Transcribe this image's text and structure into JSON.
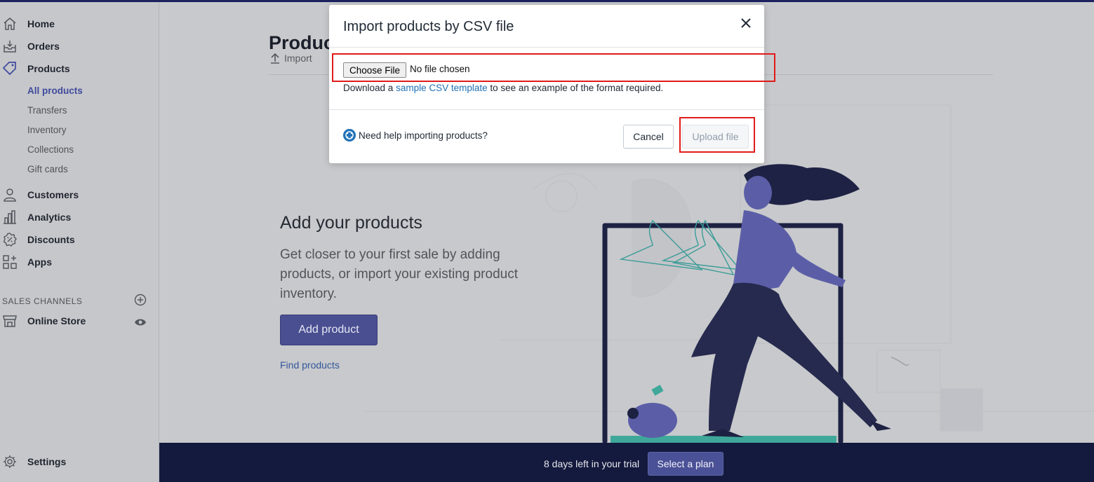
{
  "sidebar": {
    "items": [
      {
        "label": "Home",
        "icon": "home-icon"
      },
      {
        "label": "Orders",
        "icon": "orders-icon"
      },
      {
        "label": "Products",
        "icon": "tag-icon"
      },
      {
        "label": "Customers",
        "icon": "person-icon"
      },
      {
        "label": "Analytics",
        "icon": "bar-chart-icon"
      },
      {
        "label": "Discounts",
        "icon": "discount-icon"
      },
      {
        "label": "Apps",
        "icon": "apps-grid-icon"
      }
    ],
    "products_sub": [
      "All products",
      "Transfers",
      "Inventory",
      "Collections",
      "Gift cards"
    ],
    "sales_channels_title": "SALES CHANNELS",
    "online_store": "Online Store",
    "settings": "Settings"
  },
  "main": {
    "page_title": "Produc",
    "import_label": "Import",
    "empty_state": {
      "title": "Add your products",
      "description": "Get closer to your first sale by adding products, or import your existing product inventory.",
      "add_button": "Add product",
      "find_link": "Find products"
    }
  },
  "trial_bar": {
    "text": "8 days left in your trial",
    "button": "Select a plan"
  },
  "modal": {
    "title": "Import products by CSV file",
    "choose_file": "Choose File",
    "no_file": "No file chosen",
    "csv_help_prefix": "Download a ",
    "csv_help_link": "sample CSV template",
    "csv_help_suffix": " to see an example of the format required.",
    "help_link": "Need help importing products?",
    "cancel": "Cancel",
    "upload": "Upload file"
  },
  "colors": {
    "accent": "#4a4f91",
    "link": "#2072b8",
    "highlight": "#e01b1b",
    "trial_bar": "#141a3d"
  }
}
